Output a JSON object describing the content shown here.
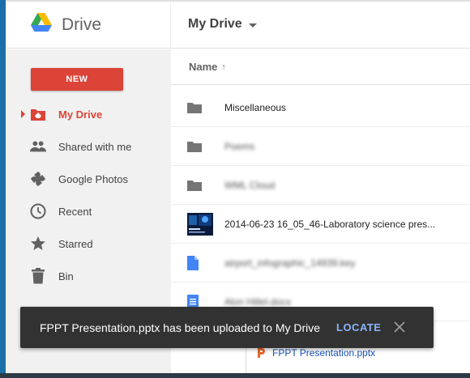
{
  "app": {
    "brand": "Drive",
    "location": "My Drive"
  },
  "sidebar": {
    "new_label": "NEW",
    "items": [
      {
        "label": "My Drive",
        "icon": "my-drive-icon",
        "active": true
      },
      {
        "label": "Shared with me",
        "icon": "people-icon"
      },
      {
        "label": "Google Photos",
        "icon": "photos-pinwheel-icon"
      },
      {
        "label": "Recent",
        "icon": "clock-icon"
      },
      {
        "label": "Starred",
        "icon": "star-icon"
      },
      {
        "label": "Bin",
        "icon": "trash-icon"
      }
    ]
  },
  "list": {
    "column_name": "Name",
    "sort_indicator": "↑",
    "rows": [
      {
        "name": "Miscellaneous",
        "type": "folder"
      },
      {
        "name": "Poems",
        "type": "folder",
        "blurred": true
      },
      {
        "name": "WML Cloud",
        "type": "folder",
        "blurred": true
      },
      {
        "name": "2014-06-23 16_05_46-Laboratory science pres...",
        "type": "image"
      },
      {
        "name": "airport_infographic_14939.key",
        "type": "file",
        "blurred": true
      },
      {
        "name": "Alon Hillel.docx",
        "type": "doc",
        "blurred": true
      }
    ]
  },
  "upload": {
    "file_name": "FPPT Presentation.pptx"
  },
  "snackbar": {
    "message": "FPPT Presentation.pptx has been uploaded to My Drive",
    "action": "LOCATE"
  },
  "colors": {
    "accent_red": "#db4437",
    "snackbar_bg": "#323232",
    "action_blue": "#8ab4f8",
    "link_blue": "#1a55b8"
  }
}
